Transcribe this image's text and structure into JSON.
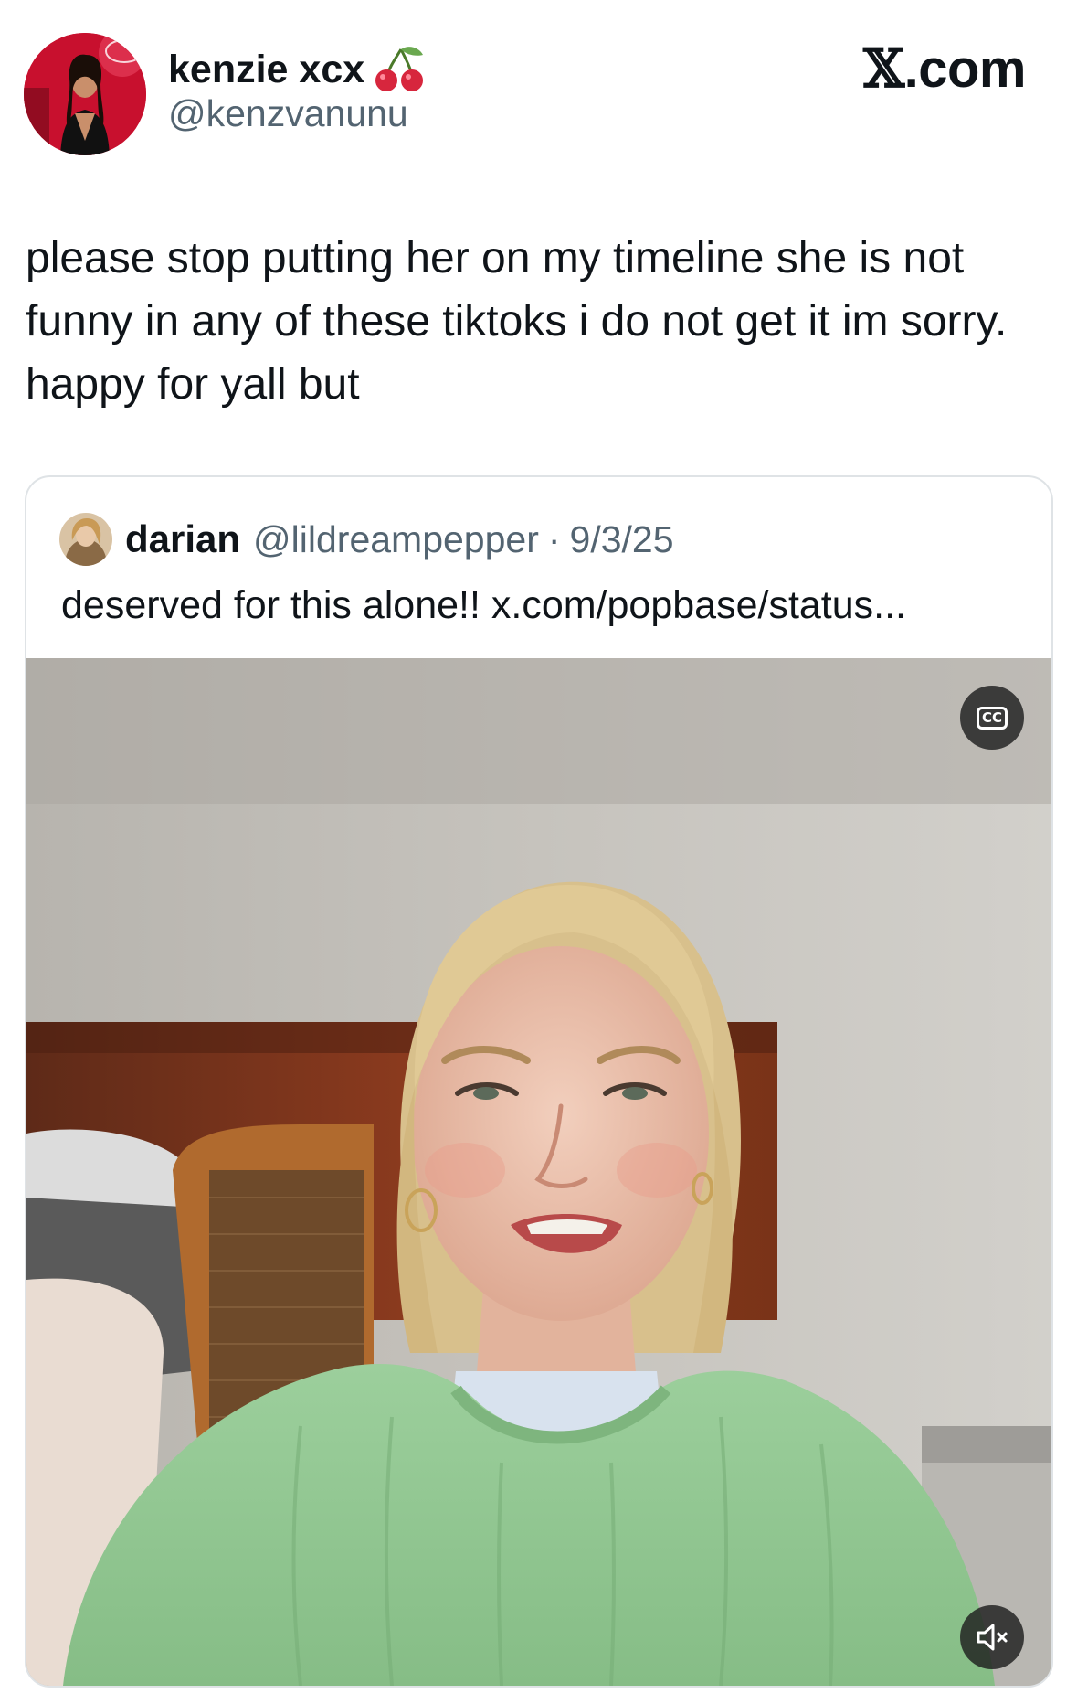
{
  "author": {
    "display_name": "kenzie xcx",
    "name_emoji": "cherries-emoji",
    "handle": "@kenzvanunu",
    "avatar": "profile-photo"
  },
  "site_label": {
    "glyph": "𝕏",
    "suffix": ".com"
  },
  "tweet": {
    "text": "please stop putting her on my timeline she is not funny in any of these tiktoks i do not get it im sorry. happy for yall but"
  },
  "quoted_tweet": {
    "display_name": "darian",
    "handle": "@lildreampepper",
    "separator": "·",
    "date": "9/3/25",
    "text": "deserved for this alone!! x.com/popbase/status...",
    "media": {
      "type": "video",
      "captions_label": "CC",
      "captions_icon": "closed-captions-icon",
      "volume_icon": "muted-speaker-icon"
    }
  },
  "colors": {
    "text_primary": "#0f1419",
    "text_secondary": "#536471",
    "card_border": "#dfe3e6"
  }
}
